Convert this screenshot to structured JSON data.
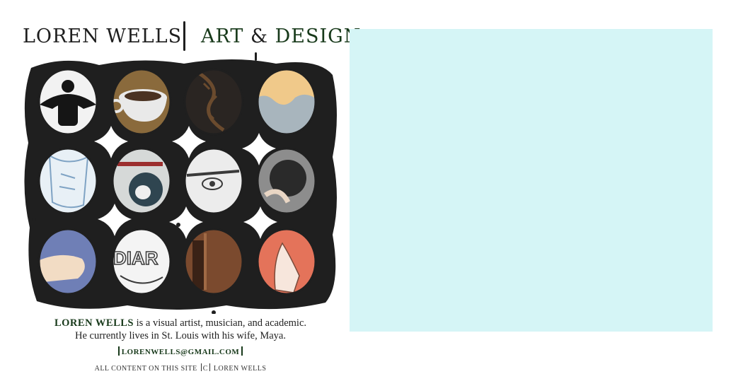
{
  "header": {
    "name": "LOREN WELLS",
    "tag_art": "ART",
    "tag_amp": "&",
    "tag_design": "DESIGN"
  },
  "gallery": {
    "thumbnails": [
      {
        "icon": "emblem-icon",
        "fill": "#f2f2f2",
        "ink": "#151515"
      },
      {
        "icon": "coffee-cup-icon",
        "fill": "#8a6a3c",
        "ink": "#e9e9e9"
      },
      {
        "icon": "barbed-wire-icon",
        "fill": "#2a2522",
        "ink": "#6b4b2e"
      },
      {
        "icon": "wave-icon",
        "fill": "#f0c98a",
        "ink": "#a8b5bd"
      },
      {
        "icon": "clothing-sketch-icon",
        "fill": "#e8f0f6",
        "ink": "#7fa3c4"
      },
      {
        "icon": "skull-icon",
        "fill": "#d6d9d8",
        "ink": "#2f4550"
      },
      {
        "icon": "eye-icon",
        "fill": "#ececec",
        "ink": "#3a3a3a"
      },
      {
        "icon": "figure-icon",
        "fill": "#8d8d8d",
        "ink": "#2a2a2a"
      },
      {
        "icon": "hand-icon",
        "fill": "#6f7fb6",
        "ink": "#f2dcc4"
      },
      {
        "icon": "lettering-icon",
        "fill": "#f4f4f4",
        "ink": "#3a3a3a"
      },
      {
        "icon": "door-icon",
        "fill": "#7b4a2e",
        "ink": "#3a2216"
      },
      {
        "icon": "praying-hand-icon",
        "fill": "#e4735a",
        "ink": "#f7e6dc"
      }
    ]
  },
  "bio": {
    "name": "LOREN WELLS",
    "line1_rest": " is a visual artist, musician, and academic.",
    "line2": "He currently lives in St. Louis with his wife, Maya."
  },
  "contact": {
    "email": "LORENWELLS@GMAIL.COM"
  },
  "copyright": {
    "prefix": "ALL CONTENT ON THIS SITE",
    "mark": "C",
    "owner": "LOREN WELLS"
  },
  "colors": {
    "accent": "#17391a",
    "preview_bg": "#d5f5f6",
    "mosaic_ink": "#1f1f1f"
  }
}
